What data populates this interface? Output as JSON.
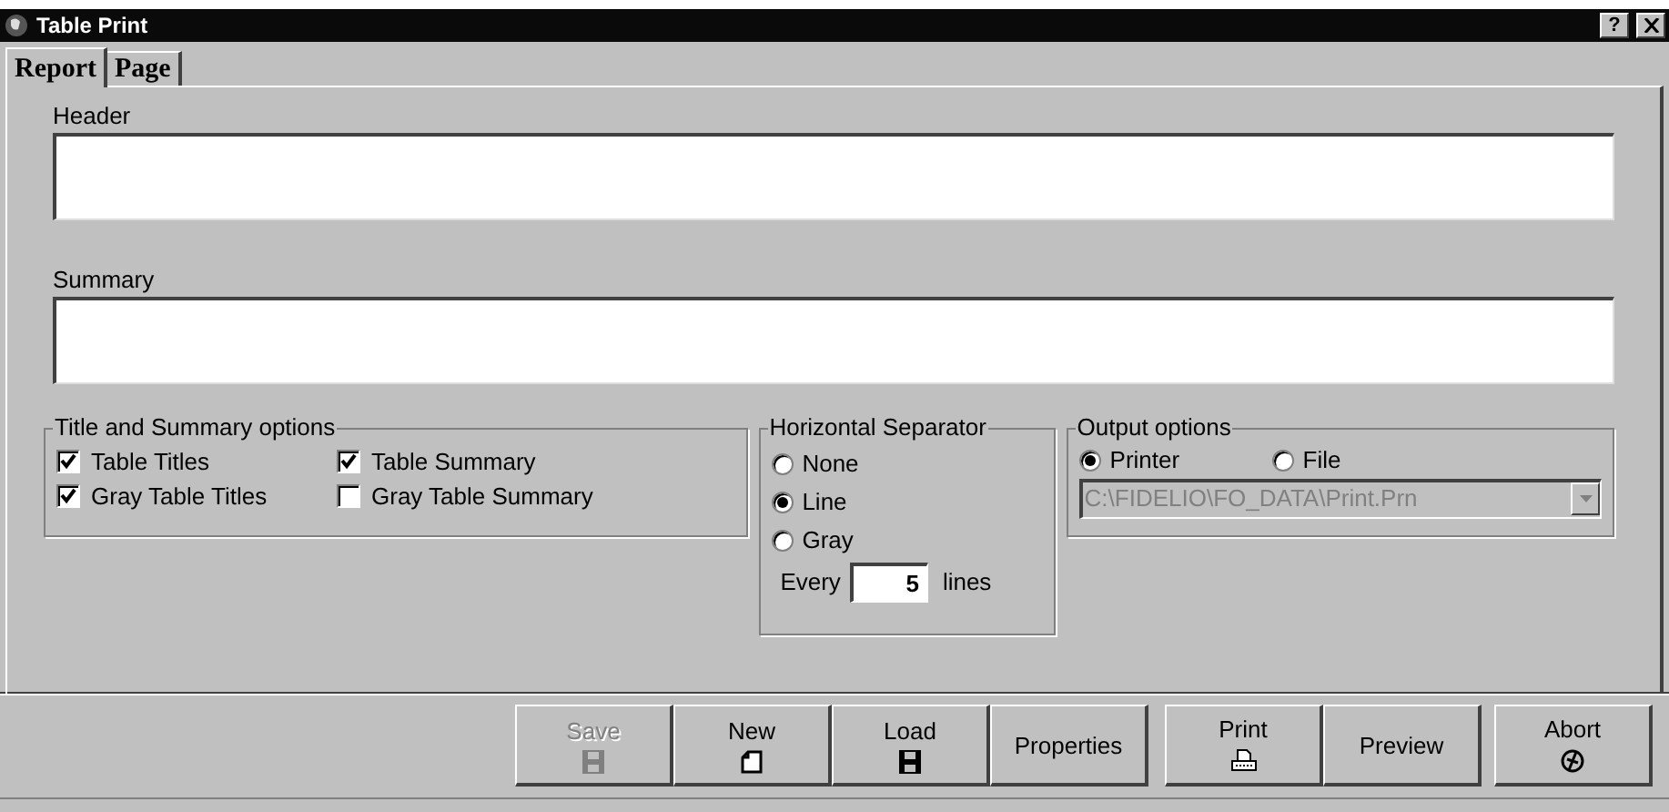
{
  "window": {
    "title": "Table Print",
    "help_button": "?"
  },
  "tabs": [
    {
      "label": "Report",
      "selected": true
    },
    {
      "label": "Page",
      "selected": false
    }
  ],
  "fields": [
    {
      "label": "Header"
    },
    {
      "label": "Summary"
    }
  ],
  "title_summary_options": {
    "title": "Title and Summary options",
    "checkboxes": [
      {
        "label": "Table Titles",
        "checked": true
      },
      {
        "label": "Table Summary",
        "checked": true
      },
      {
        "label": "Gray Table Titles",
        "checked": true
      },
      {
        "label": "Gray Table Summary",
        "checked": false
      }
    ]
  },
  "horizontal_separator": {
    "title": "Horizontal Separator",
    "options": [
      {
        "label": "None",
        "selected": false
      },
      {
        "label": "Line",
        "selected": true
      },
      {
        "label": "Gray",
        "selected": false
      }
    ],
    "every": {
      "label": "Every",
      "value": "5",
      "unit": "lines"
    }
  },
  "output_options": {
    "title": "Output options",
    "options": [
      {
        "label": "Printer",
        "selected": true
      },
      {
        "label": "File",
        "selected": false
      }
    ],
    "path": {
      "value": "C:\\FIDELIO\\FO_DATA\\Print.Prn",
      "disabled": true
    }
  },
  "buttons": [
    {
      "label": "Save",
      "disabled": true
    },
    {
      "label": "New",
      "disabled": false
    },
    {
      "label": "Load",
      "disabled": false
    },
    {
      "label": "Properties",
      "disabled": false
    },
    {
      "label": "Print",
      "disabled": false
    },
    {
      "label": "Preview",
      "disabled": false
    },
    {
      "label": "Abort",
      "disabled": false
    }
  ]
}
